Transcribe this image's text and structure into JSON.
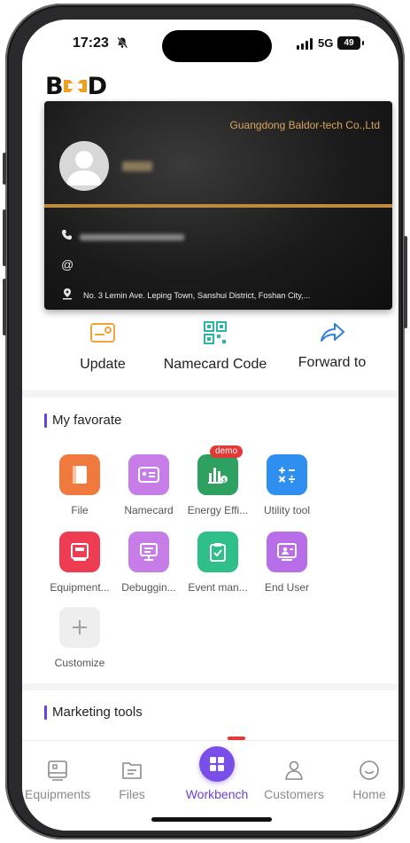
{
  "status_bar": {
    "time": "17:23",
    "network": "5G",
    "battery": "49"
  },
  "logo": {
    "letters": [
      "B",
      "D"
    ]
  },
  "card": {
    "company": "Guangdong Baldor-tech Co.,Ltd",
    "address": "No. 3 Lemin Ave. Leping Town, Sanshui District, Foshan City,..."
  },
  "actions": [
    {
      "label": "Update",
      "icon": "id-card-icon"
    },
    {
      "label": "Namecard Code",
      "icon": "qr-code-icon"
    },
    {
      "label": "Forward to",
      "icon": "share-arrow-icon"
    }
  ],
  "favorite": {
    "title": "My favorate",
    "items": [
      {
        "label": "File",
        "icon": "book-icon",
        "color": "#f07a3e"
      },
      {
        "label": "Namecard",
        "icon": "namecard-icon",
        "color": "#c77de8"
      },
      {
        "label": "Energy Effi...",
        "icon": "bar-chart-icon",
        "color": "#2ea05f",
        "badge": "demo"
      },
      {
        "label": "Utility tool",
        "icon": "calculator-icon",
        "color": "#2e8ff0"
      },
      {
        "label": "Equipment...",
        "icon": "equipment-icon",
        "color": "#ee3d52"
      },
      {
        "label": "Debuggin...",
        "icon": "monitor-icon",
        "color": "#c77de8"
      },
      {
        "label": "Event man...",
        "icon": "clipboard-icon",
        "color": "#2fbf8a"
      },
      {
        "label": "End User",
        "icon": "user-screen-icon",
        "color": "#b86ee6"
      },
      {
        "label": "Customize",
        "icon": "plus-icon",
        "color": "#eeeeee"
      }
    ]
  },
  "marketing": {
    "title": "Marketing tools"
  },
  "tabs": [
    {
      "label": "Equipments",
      "icon": "equipment-tab-icon"
    },
    {
      "label": "Files",
      "icon": "files-tab-icon"
    },
    {
      "label": "Workbench",
      "icon": "workbench-tab-icon",
      "active": true
    },
    {
      "label": "Customers",
      "icon": "customers-tab-icon"
    },
    {
      "label": "Home",
      "icon": "home-smile-icon"
    }
  ],
  "colors": {
    "accent": "#6a3fe0",
    "card_gold": "#d9a45a",
    "action_orange": "#f2a33a",
    "action_teal": "#2ab5a5",
    "action_blue": "#2e7fe0"
  }
}
